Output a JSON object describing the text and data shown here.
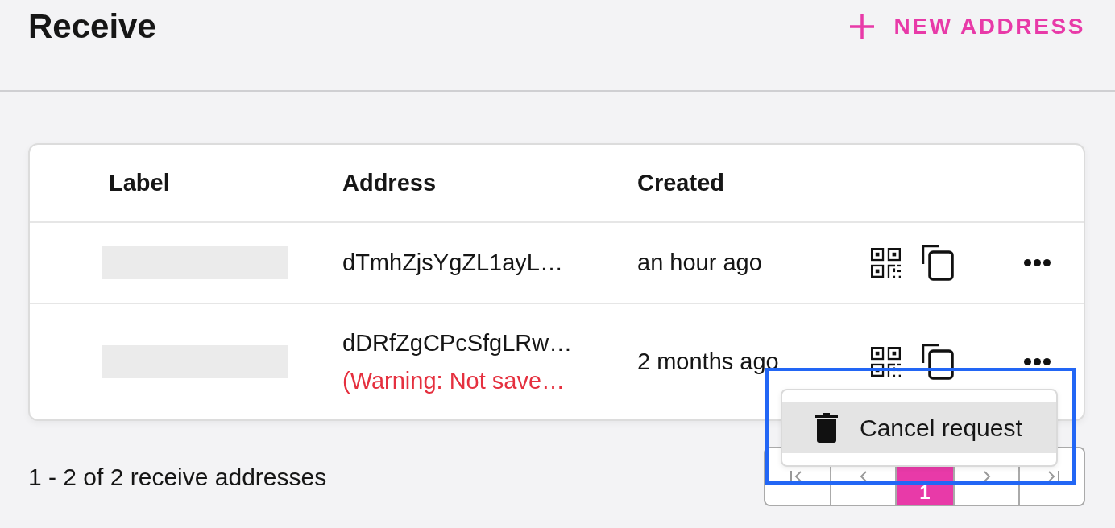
{
  "header": {
    "title": "Receive",
    "new_address_button": "NEW ADDRESS"
  },
  "table": {
    "columns": [
      "Label",
      "Address",
      "Created"
    ],
    "rows": [
      {
        "address": "dTmhZjsYgZL1ayL…",
        "created": "an hour ago"
      },
      {
        "address": "dDRfZgCPcSfgLRw…",
        "warning": "(Warning: Not save…",
        "created": "2 months ago"
      }
    ]
  },
  "footer": {
    "summary": "1 - 2 of 2 receive addresses"
  },
  "pagination": {
    "pages": [
      {
        "label": "1",
        "selected": true
      }
    ]
  },
  "context_menu": {
    "outlined": true,
    "items": [
      {
        "label": "Cancel request",
        "highlighted": true
      }
    ]
  }
}
